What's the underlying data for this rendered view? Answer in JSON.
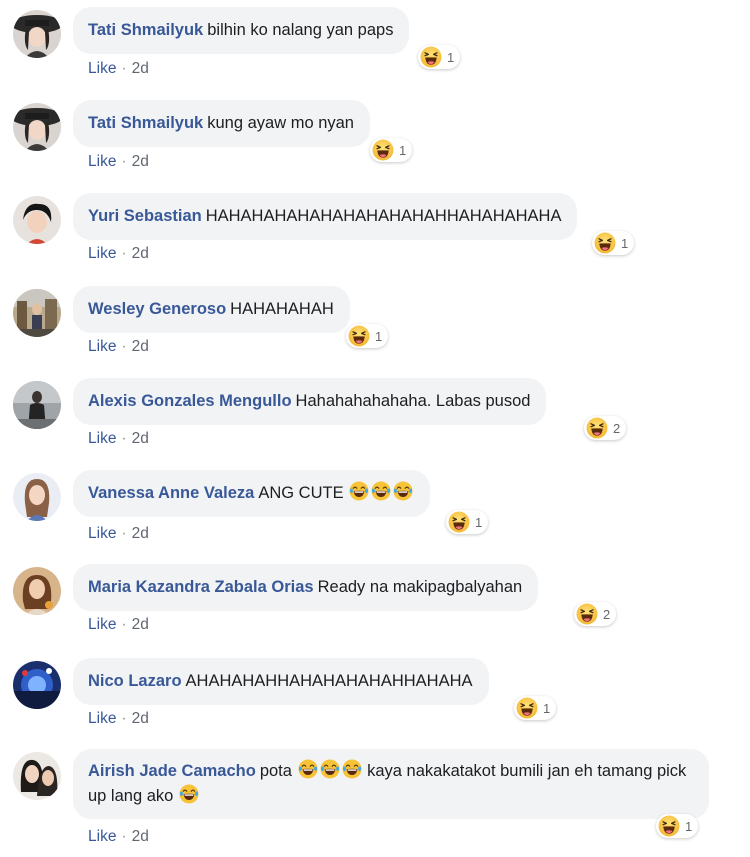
{
  "colors": {
    "author": "#385898",
    "bubble_bg": "#f2f3f5",
    "meta": "#606770"
  },
  "icons": {
    "laugh_emoji": "haha-emoji-icon",
    "tears_emoji": "tears-of-joy-emoji-icon"
  },
  "comments": [
    {
      "author": "Tati Shmailyuk",
      "text": "bilhin ko nalang yan paps",
      "reaction_count": "1",
      "like_label": "Like",
      "separator": "·",
      "time": "2d"
    },
    {
      "author": "Tati Shmailyuk",
      "text": "kung ayaw mo nyan",
      "reaction_count": "1",
      "like_label": "Like",
      "separator": "·",
      "time": "2d"
    },
    {
      "author": "Yuri Sebastian",
      "text": "HAHAHAHAHAHAHAHAHAHAHHAHAHAHAHA",
      "reaction_count": "1",
      "like_label": "Like",
      "separator": "·",
      "time": "2d"
    },
    {
      "author": "Wesley Generoso",
      "text": "HAHAHAHAH",
      "reaction_count": "1",
      "like_label": "Like",
      "separator": "·",
      "time": "2d"
    },
    {
      "author": "Alexis Gonzales Mengullo",
      "text": "Hahahahahahaha. Labas pusod",
      "reaction_count": "2",
      "like_label": "Like",
      "separator": "·",
      "time": "2d"
    },
    {
      "author": "Vanessa Anne Valeza",
      "text": "ANG CUTE",
      "reaction_count": "1",
      "like_label": "Like",
      "separator": "·",
      "time": "2d"
    },
    {
      "author": "Maria Kazandra Zabala Orias",
      "text": "Ready na makipagbalyahan",
      "reaction_count": "2",
      "like_label": "Like",
      "separator": "·",
      "time": "2d"
    },
    {
      "author": "Nico Lazaro",
      "text": "AHAHAHAHHAHAHAHAHAHHAHAHA",
      "reaction_count": "1",
      "like_label": "Like",
      "separator": "·",
      "time": "2d"
    },
    {
      "author": "Airish Jade Camacho",
      "text_part1": "pota",
      "text_part2": "kaya nakakatakot bumili jan eh tamang pick up lang ako",
      "reaction_count": "1",
      "like_label": "Like",
      "separator": "·",
      "time": "2d"
    }
  ]
}
